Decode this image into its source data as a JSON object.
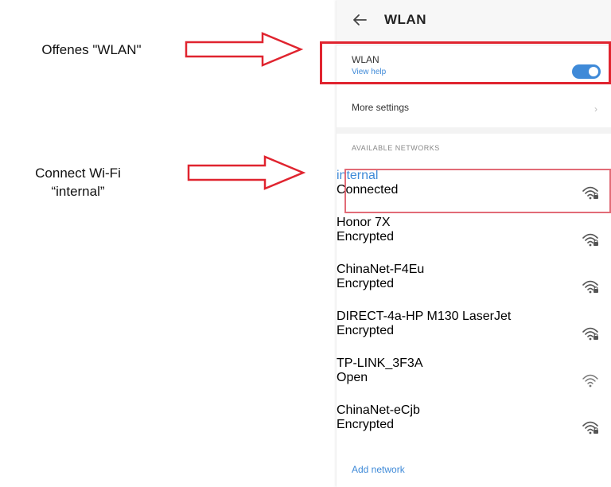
{
  "annotations": {
    "label_1": "Offenes \"WLAN\"",
    "label_2_line1": "Connect Wi-Fi",
    "label_2_line2": "“internal”",
    "arrow_color": "#e0242f"
  },
  "screen": {
    "title": "WLAN",
    "wlan": {
      "label": "WLAN",
      "help": "View help",
      "enabled": true
    },
    "more_settings": "More settings",
    "section_header": "AVAILABLE NETWORKS",
    "networks": [
      {
        "name": "internal",
        "status": "Connected",
        "icon": "wifi-lock-icon"
      },
      {
        "name": "Honor 7X",
        "status": "Encrypted",
        "icon": "wifi-lock-icon"
      },
      {
        "name": "ChinaNet-F4Eu",
        "status": "Encrypted",
        "icon": "wifi-lock-icon"
      },
      {
        "name": "DIRECT-4a-HP M130 LaserJet",
        "status": "Encrypted",
        "icon": "wifi-lock-icon"
      },
      {
        "name": "TP-LINK_3F3A",
        "status": "Open",
        "icon": "wifi-icon"
      },
      {
        "name": "ChinaNet-eCjb",
        "status": "Encrypted",
        "icon": "wifi-lock-icon"
      }
    ],
    "add_network": "Add network",
    "accent_color": "#3f8ad8"
  }
}
